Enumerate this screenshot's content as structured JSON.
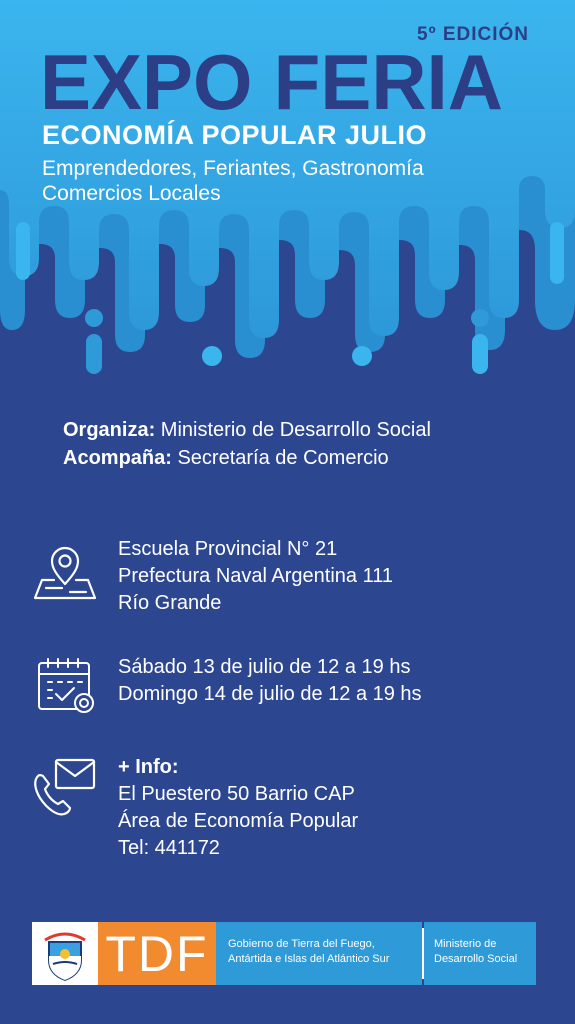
{
  "header": {
    "edition": "5º EDICIÓN",
    "title": "EXPO FERIA",
    "subtitle": "ECONOMÍA POPULAR JULIO",
    "tagline_line1": "Emprendedores, Feriantes, Gastronomía",
    "tagline_line2": "Comercios Locales"
  },
  "colors": {
    "background": "#2c4690",
    "header_light": "#38b1ec",
    "header_mid": "#2f9ad8",
    "title": "#2c3f86",
    "accent_orange": "#f28b30"
  },
  "organizers": {
    "organiza_label": "Organiza:",
    "organiza_value": " Ministerio de Desarrollo Social",
    "acompana_label": "Acompaña:",
    "acompana_value": " Secretaría de Comercio"
  },
  "location": {
    "icon": "map-pin-icon",
    "line1": "Escuela Provincial N° 21",
    "line2": "Prefectura Naval Argentina 111",
    "line3": "Río Grande"
  },
  "schedule": {
    "icon": "calendar-icon",
    "line1": "Sábado 13 de julio de 12 a 19 hs",
    "line2": "Domingo 14 de julio de 12 a 19 hs"
  },
  "info": {
    "icon": "mail-phone-icon",
    "label": "+ Info:",
    "line1": "El Puestero 50 Barrio CAP",
    "line2": "Área de Economía Popular",
    "line3": "Tel: 441172"
  },
  "footer": {
    "brand": "TDF",
    "gov_line1": "Gobierno de Tierra del Fuego,",
    "gov_line2": "Antártida e Islas del Atlántico Sur",
    "ministry_line1": "Ministerio de",
    "ministry_line2": "Desarrollo Social"
  }
}
